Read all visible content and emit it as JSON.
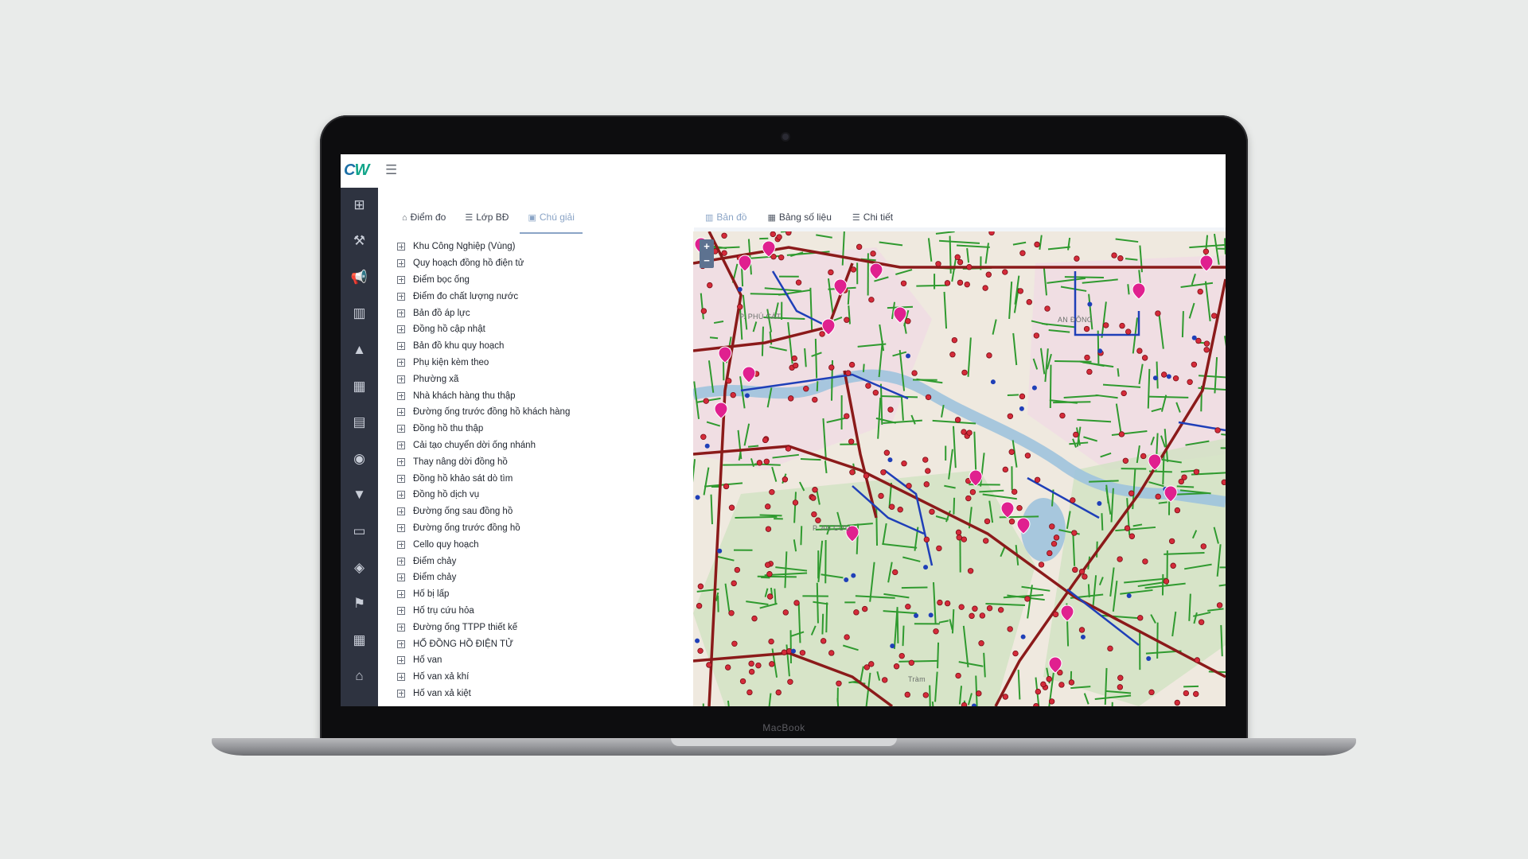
{
  "device": {
    "bezel_label": "MacBook"
  },
  "app": {
    "logo": {
      "text_a": "C",
      "text_b": "W"
    },
    "menu_icon": "hamburger-icon"
  },
  "sidebar": {
    "items": [
      {
        "icon": "sitemap-icon",
        "glyph": "⊞"
      },
      {
        "icon": "wrench-icon",
        "glyph": "⚒"
      },
      {
        "icon": "megaphone-icon",
        "glyph": "📢"
      },
      {
        "icon": "bar-chart-icon",
        "glyph": "▥"
      },
      {
        "icon": "warning-icon",
        "glyph": "▲"
      },
      {
        "icon": "table-icon",
        "glyph": "▦"
      },
      {
        "icon": "document-icon",
        "glyph": "▤"
      },
      {
        "icon": "target-icon",
        "glyph": "◉"
      },
      {
        "icon": "filter-icon",
        "glyph": "▼"
      },
      {
        "icon": "folder-icon",
        "glyph": "▭"
      },
      {
        "icon": "cube-icon",
        "glyph": "◈"
      },
      {
        "icon": "hydrant-icon",
        "glyph": "⚑"
      },
      {
        "icon": "calendar-icon",
        "glyph": "▦"
      },
      {
        "icon": "home-icon",
        "glyph": "⌂"
      }
    ]
  },
  "left_tabs": [
    {
      "label": "Điểm đo",
      "icon": "home-icon",
      "glyph": "⌂",
      "active": false
    },
    {
      "label": "Lớp BĐ",
      "icon": "layers-icon",
      "glyph": "☰",
      "active": false
    },
    {
      "label": "Chú giải",
      "icon": "image-icon",
      "glyph": "▣",
      "active": true
    }
  ],
  "right_tabs": [
    {
      "label": "Bản đồ",
      "icon": "map-icon",
      "glyph": "▥",
      "active": true
    },
    {
      "label": "Bảng số liệu",
      "icon": "calendar-icon",
      "glyph": "▦",
      "active": false
    },
    {
      "label": "Chi tiết",
      "icon": "list-icon",
      "glyph": "☰",
      "active": false
    }
  ],
  "layers": [
    "Khu Công Nghiệp (Vùng)",
    "Quy hoạch đồng hồ điện tử",
    "Điểm bọc ống",
    "Điểm đo chất lượng nước",
    "Bản đồ áp lực",
    "Đồng hồ cập nhật",
    "Bản đồ khu quy hoạch",
    "Phụ kiện kèm theo",
    "Phường xã",
    "Nhà khách hàng thu thập",
    "Đường ống trước đồng hồ khách hàng",
    "Đồng hồ thu thập",
    "Cải tạo chuyển dời ống nhánh",
    "Thay nâng dời đồng hồ",
    "Đồng hồ khảo sát dò tìm",
    "Đồng hồ dịch vụ",
    "Đường ống sau đồng hồ",
    "Đường ống trước đồng hồ",
    "Cello quy hoạch",
    "Điểm chảy",
    "Điểm chảy",
    "Hố bị lấp",
    "Hố trụ cứu hỏa",
    "Đường ống TTPP thiết kế",
    "HỐ ĐỒNG HỒ ĐIỆN TỬ",
    "Hố van",
    "Hố van xả khí",
    "Hố van xả kiệt"
  ],
  "map": {
    "zoom_in": "+",
    "zoom_out": "−",
    "labels": [
      "P. AN CƯU",
      "AN ĐÔNG",
      "Tràm",
      "P. PHÚ CÁT"
    ],
    "colors": {
      "distribution_pipe": "#2f9a2f",
      "main_pipe": "#8b1a1a",
      "transmission_pipe": "#1f3fb8",
      "valve": "#d42b3a",
      "meter_marker": "#e0208f",
      "river": "#9fc3dd",
      "urban_area": "#f0dde3",
      "green_area": "#cfe2c0"
    }
  }
}
